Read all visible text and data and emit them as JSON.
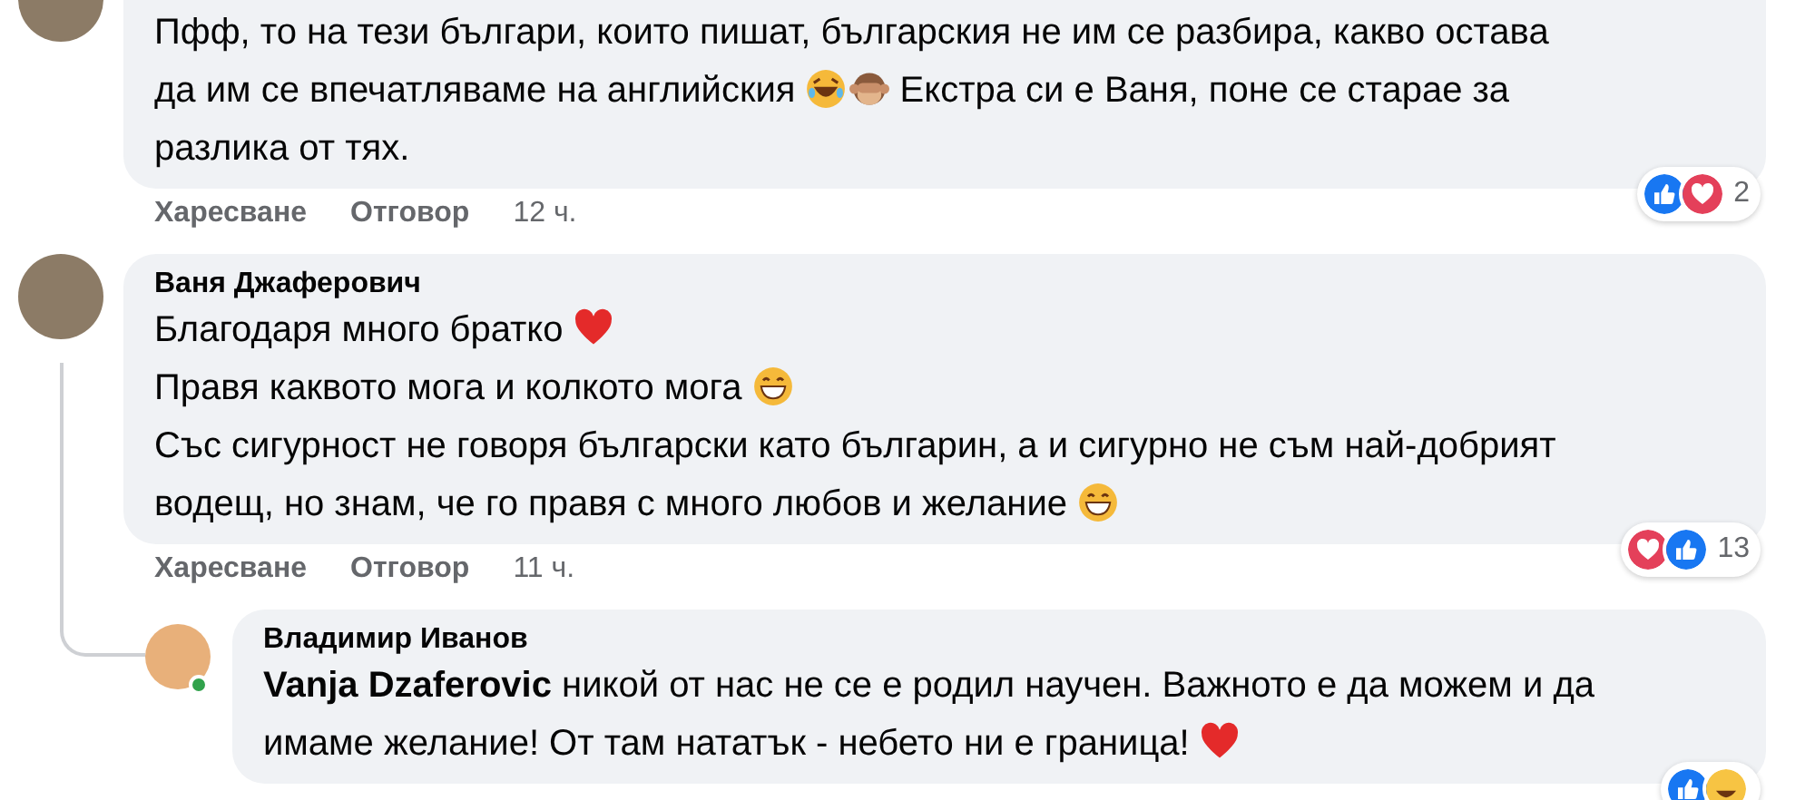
{
  "comments": [
    {
      "online": false,
      "lines": [
        [
          {
            "kind": "text",
            "text": "Пфф, то на тези българи, които пишат, българския не им се разбира, какво остава"
          }
        ],
        [
          {
            "kind": "text",
            "text": "да им се впечатляваме на английския"
          },
          {
            "kind": "laugh"
          },
          {
            "kind": "monkey"
          },
          {
            "kind": "text",
            "text": " Екстра си е Ваня, поне се старае за"
          }
        ],
        [
          {
            "kind": "text",
            "text": "разлика от тях."
          }
        ]
      ],
      "actions": [
        "Харесване",
        "Отговор"
      ],
      "time": "12 ч.",
      "reactions": [
        {
          "kind": "like"
        },
        {
          "kind": "love"
        }
      ],
      "reaction_count": "2"
    },
    {
      "author": "Ваня Джаферович",
      "online": false,
      "lines": [
        [
          {
            "kind": "text",
            "text": "Благодаря много братко"
          },
          {
            "kind": "heart"
          }
        ],
        [
          {
            "kind": "text",
            "text": "Правя каквото мога и колкото мога"
          },
          {
            "kind": "grin"
          }
        ],
        [
          {
            "kind": "text",
            "text": "Със сигурност не говоря български като българин, а и сигурно не съм най-добрият"
          }
        ],
        [
          {
            "kind": "text",
            "text": "водещ, но знам, че го правя с много любов и желание"
          },
          {
            "kind": "grin"
          }
        ]
      ],
      "actions": [
        "Харесване",
        "Отговор"
      ],
      "time": "11 ч.",
      "reactions": [
        {
          "kind": "love"
        },
        {
          "kind": "like"
        }
      ],
      "reaction_count": "13",
      "replies": [
        {
          "author": "Владимир Иванов",
          "online": true,
          "lines": [
            [
              {
                "kind": "text",
                "text": "**Vanja Dzaferovic** никой от нас не се е родил научен. Важното е да можем и да"
              }
            ],
            [
              {
                "kind": "text",
                "text": "имаме желание! От там нататък - небето ни е граница!"
              },
              {
                "kind": "heart"
              }
            ]
          ],
          "reactions": [
            {
              "kind": "like"
            },
            {
              "kind": "haha"
            }
          ]
        }
      ]
    }
  ]
}
